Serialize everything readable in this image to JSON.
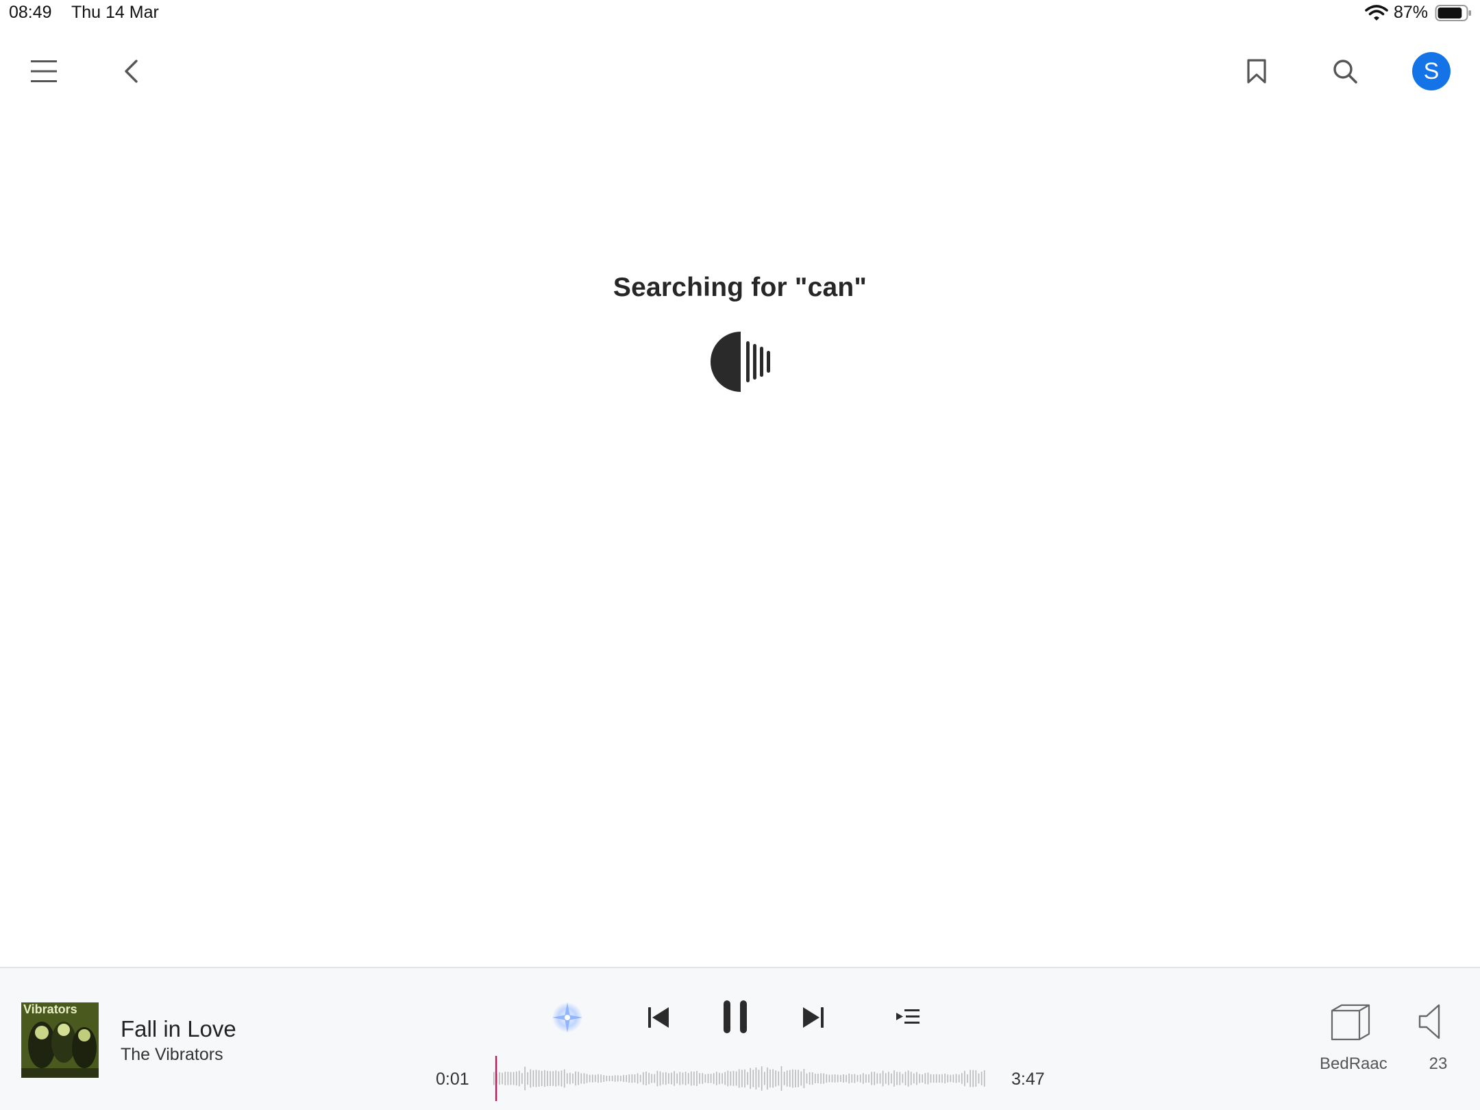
{
  "status_bar": {
    "time": "08:49",
    "date": "Thu 14 Mar",
    "battery_percent": "87%",
    "battery_level": 0.87
  },
  "nav": {
    "avatar_initial": "S",
    "icons": [
      "menu-icon",
      "back-chevron-icon",
      "bookmark-icon",
      "search-icon"
    ],
    "avatar_color": "#1473e6"
  },
  "main": {
    "search_status": "Searching for \"can\""
  },
  "player": {
    "track_title": "Fall in Love",
    "artist": "The Vibrators",
    "album_art_text": "Vibrators",
    "time_elapsed": "0:01",
    "time_total": "3:47",
    "progress_fraction": 0.004,
    "zone_label": "BedRaac",
    "volume_label": "23",
    "accent_color": "#c2185b",
    "radio_color": "#8fb5ff"
  }
}
